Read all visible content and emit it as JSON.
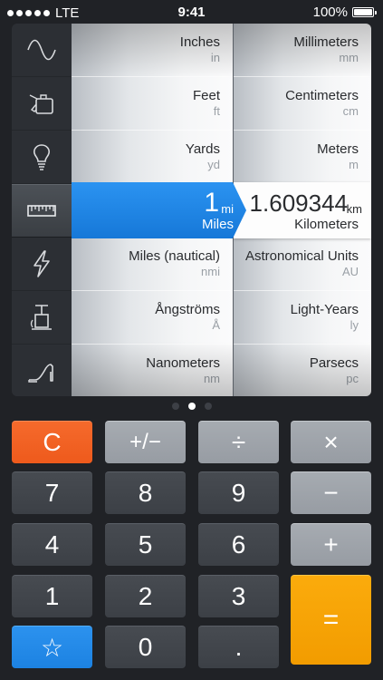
{
  "status": {
    "carrier": "LTE",
    "time": "9:41",
    "battery": "100%"
  },
  "categories": [
    {
      "icon": "sine-wave-icon"
    },
    {
      "icon": "gas-can-icon"
    },
    {
      "icon": "light-bulb-icon"
    },
    {
      "icon": "ruler-icon",
      "active": true
    },
    {
      "icon": "lightning-icon"
    },
    {
      "icon": "pressure-gauge-icon"
    },
    {
      "icon": "high-heel-icon"
    }
  ],
  "from_units": [
    {
      "name": "Inches",
      "abbr": "in"
    },
    {
      "name": "Feet",
      "abbr": "ft"
    },
    {
      "name": "Yards",
      "abbr": "yd"
    },
    {
      "name": "Miles",
      "abbr": "mi"
    },
    {
      "name": "Miles (nautical)",
      "abbr": "nmi"
    },
    {
      "name": "Ångströms",
      "abbr": "Å"
    },
    {
      "name": "Nanometers",
      "abbr": "nm"
    }
  ],
  "to_units": [
    {
      "name": "Millimeters",
      "abbr": "mm"
    },
    {
      "name": "Centimeters",
      "abbr": "cm"
    },
    {
      "name": "Meters",
      "abbr": "m"
    },
    {
      "name": "Kilometers",
      "abbr": "km"
    },
    {
      "name": "Astronomical Units",
      "abbr": "AU"
    },
    {
      "name": "Light-Years",
      "abbr": "ly"
    },
    {
      "name": "Parsecs",
      "abbr": "pc"
    }
  ],
  "selected_from": {
    "value": "1",
    "unit": "mi",
    "name": "Miles"
  },
  "selected_to": {
    "value": "1.609344",
    "unit": "km",
    "name": "Kilometers"
  },
  "pager": {
    "count": 3,
    "active": 1
  },
  "keys": {
    "clear": "C",
    "sign": "+/−",
    "divide": "÷",
    "multiply": "×",
    "seven": "7",
    "eight": "8",
    "nine": "9",
    "minus": "−",
    "four": "4",
    "five": "5",
    "six": "6",
    "plus": "+",
    "one": "1",
    "two": "2",
    "three": "3",
    "equals": "=",
    "favorite": "☆",
    "zero": "0",
    "decimal": "."
  },
  "colors": {
    "accent_blue": "#1c82e2",
    "clear_orange": "#ee5a1c",
    "equals_yellow": "#f29c00"
  }
}
